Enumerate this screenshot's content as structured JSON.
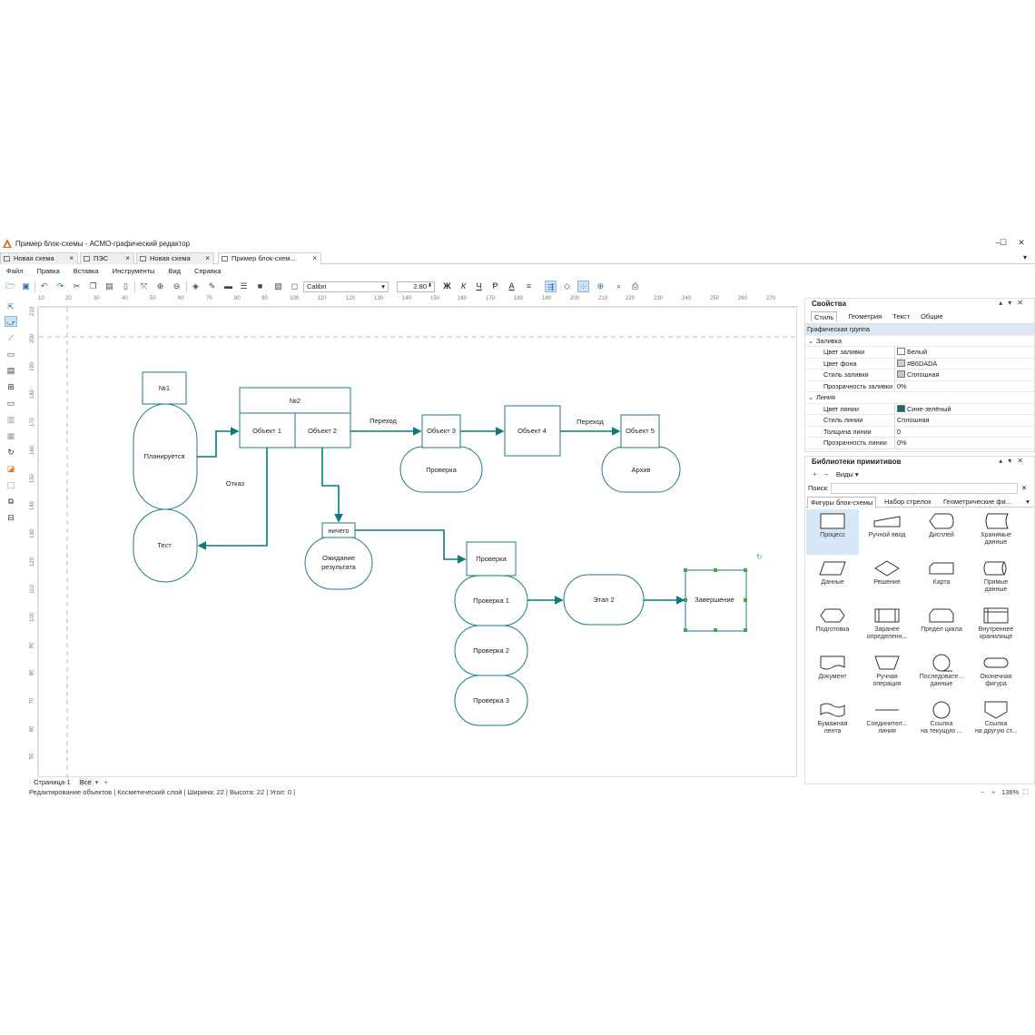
{
  "window": {
    "title": "Пример блок-схемы - АСМО-графический редактор",
    "controls": [
      "–",
      "☐",
      "✕"
    ]
  },
  "tabs": [
    {
      "label": "Новая схема",
      "active": false
    },
    {
      "label": "ПЭС",
      "active": false
    },
    {
      "label": "Новая схема",
      "active": false
    },
    {
      "label": "Пример блок-схем...",
      "active": true
    }
  ],
  "menu": [
    "Файл",
    "Правка",
    "Вставка",
    "Инструменты",
    "Вид",
    "Справка"
  ],
  "toolbar": {
    "font": "Calibri",
    "font_size": "2.80",
    "bold": "Ж",
    "italic": "К",
    "underline": "Ч",
    "strike": "Ᵽ",
    "text_color": "A"
  },
  "ruler_top": [
    "10",
    "20",
    "30",
    "40",
    "50",
    "60",
    "70",
    "80",
    "90",
    "100",
    "110",
    "120",
    "130",
    "140",
    "150",
    "160",
    "170",
    "180",
    "190",
    "200",
    "210",
    "220",
    "230",
    "240",
    "250",
    "260",
    "270"
  ],
  "ruler_left": [
    "210",
    "200",
    "190",
    "180",
    "170",
    "160",
    "150",
    "140",
    "130",
    "120",
    "110",
    "100",
    "90",
    "80",
    "70",
    "60",
    "50"
  ],
  "diagram": {
    "n1": "№1",
    "plan": "Планируется",
    "test": "Тест",
    "n2": "№2",
    "obj1": "Объект 1",
    "obj2": "Объект 2",
    "obj3": "Объект 3",
    "obj4": "Объект 4",
    "obj5": "Объект 5",
    "transition1": "Переход",
    "transition2": "Переход",
    "refusal": "Отказ",
    "check_a": "Проверка",
    "archive": "Архив",
    "nothing": "ничего",
    "wait": "Ожидание\nрезультата",
    "check_header": "Проверка",
    "check1": "Проверка 1",
    "check2": "Проверка 2",
    "check3": "Проверка 3",
    "stage2": "Этап 2",
    "finish": "Завершение",
    "line_color": "#0a7a7a",
    "shape_stroke": "#1f7d85",
    "selection_color": "#3cae3c"
  },
  "pages": {
    "page": "Страница-1",
    "filter": "Все",
    "add": "+"
  },
  "status": {
    "mode": "Редактирование объектов",
    "layer": "Косметический слой",
    "width": "Ширина: 22",
    "height": "Высота: 22",
    "angle": "Угол: 0",
    "zoom": "136%"
  },
  "properties": {
    "title": "Свойства",
    "tabs": [
      "Стиль",
      "Геометрия",
      "Текст",
      "Общие"
    ],
    "group": "Графическая группа",
    "rows": [
      {
        "key": "Заливка",
        "value": "",
        "group": true
      },
      {
        "key": "Цвет заливки",
        "value": "Белый",
        "swatch": "#ffffff"
      },
      {
        "key": "Цвет фона",
        "value": "#B6DADA",
        "swatch": "#b6dada"
      },
      {
        "key": "Стиль заливки",
        "value": "Сплошная",
        "swatch": "#c8c8c8"
      },
      {
        "key": "Прозрачность заливки",
        "value": "0%"
      },
      {
        "key": "Линия",
        "value": "",
        "group": true
      },
      {
        "key": "Цвет линии",
        "value": "Сине-зелёный",
        "swatch": "#0a6e6e"
      },
      {
        "key": "Стиль линии",
        "value": "Сплошная"
      },
      {
        "key": "Толщина линии",
        "value": "0"
      },
      {
        "key": "Прозрачность линии",
        "value": "0%"
      }
    ]
  },
  "library": {
    "title": "Библиотеки примитивов",
    "views": "Виды ▾",
    "search_label": "Поиск:",
    "tabs": [
      "Фигуры блок-схемы",
      "Набор стрелок",
      "Геометрические фи..."
    ],
    "shapes": [
      {
        "label": "Процесс",
        "icon": "process-icon"
      },
      {
        "label": "Ручной ввод",
        "icon": "manual-input-icon"
      },
      {
        "label": "Дисплей",
        "icon": "display-icon"
      },
      {
        "label": "Хранимые\nданные",
        "icon": "stored-data-icon"
      },
      {
        "label": "Данные",
        "icon": "data-icon"
      },
      {
        "label": "Решение",
        "icon": "decision-icon"
      },
      {
        "label": "Карта",
        "icon": "card-icon"
      },
      {
        "label": "Прямые\nданные",
        "icon": "direct-data-icon"
      },
      {
        "label": "Подготовка",
        "icon": "preparation-icon"
      },
      {
        "label": "Заранее\nопределенн...",
        "icon": "predefined-icon"
      },
      {
        "label": "Предел цикла",
        "icon": "loop-limit-icon"
      },
      {
        "label": "Внутреннее\nхранилище",
        "icon": "internal-storage-icon"
      },
      {
        "label": "Документ",
        "icon": "document-icon"
      },
      {
        "label": "Ручная\nоперация",
        "icon": "manual-operation-icon"
      },
      {
        "label": "Последовате...\nданные",
        "icon": "sequential-data-icon"
      },
      {
        "label": "Оконечная\nфигура",
        "icon": "terminator-icon"
      },
      {
        "label": "Бумажная\nлента",
        "icon": "paper-tape-icon"
      },
      {
        "label": "Соединител...\nлиния",
        "icon": "connector-line-icon"
      },
      {
        "label": "Ссылка\nна текущую ...",
        "icon": "on-page-ref-icon"
      },
      {
        "label": "Ссылка\nна другую ст...",
        "icon": "off-page-ref-icon"
      }
    ]
  }
}
